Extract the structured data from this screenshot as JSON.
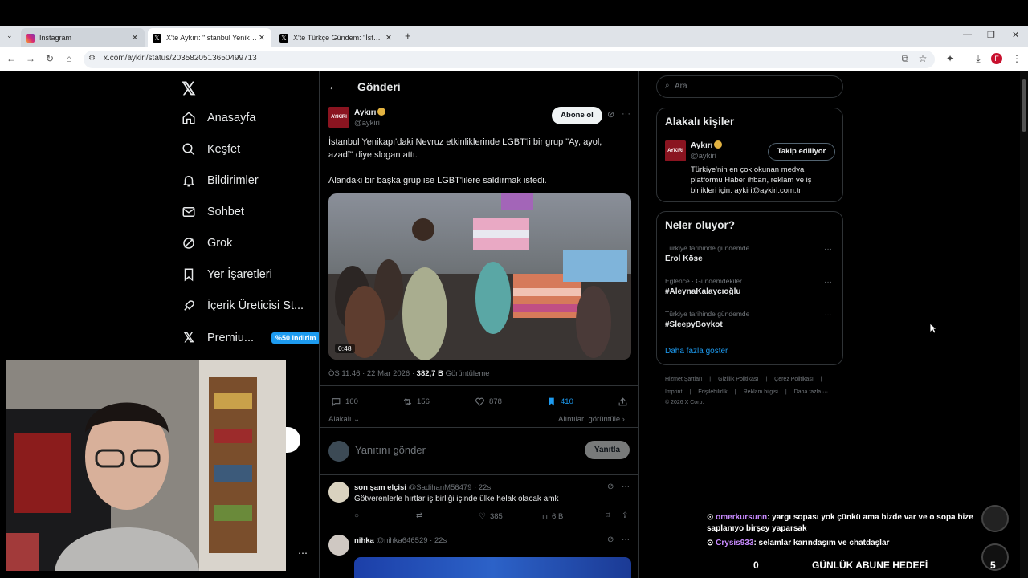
{
  "browser": {
    "tabs": [
      {
        "title": "Instagram",
        "icon": "instagram-icon"
      },
      {
        "title": "X'te Aykırı: \"İstanbul Yenikapı'da...",
        "icon": "x-logo-icon"
      },
      {
        "title": "X'te Türkçe Gündem: \"İstanbul...",
        "icon": "x-logo-icon"
      }
    ],
    "url": "x.com/aykiri/status/2035820513650499713"
  },
  "nav": {
    "items": [
      {
        "label": "Anasayfa",
        "icon": "home-icon"
      },
      {
        "label": "Keşfet",
        "icon": "search-icon"
      },
      {
        "label": "Bildirimler",
        "icon": "bell-icon"
      },
      {
        "label": "Sohbet",
        "icon": "mail-icon"
      },
      {
        "label": "Grok",
        "icon": "grok-icon"
      },
      {
        "label": "Yer İşaretleri",
        "icon": "bookmark-icon"
      },
      {
        "label": "İçerik Üreticisi St...",
        "icon": "rocket-icon"
      },
      {
        "label": "Premiu...",
        "icon": "x-logo-icon"
      }
    ],
    "premium_badge": "%50 indirim"
  },
  "post": {
    "header_title": "Gönderi",
    "author_name": "Aykırı",
    "author_handle": "@aykiri",
    "avatar_text": "AYKIRI",
    "subscribe_label": "Abone ol",
    "text_line1": "İstanbul Yenikapı'daki Nevruz etkinliklerinde LGBT'li bir grup \"Ay, ayol, azadî\" diye slogan attı.",
    "text_line2": "Alandaki bir başka grup ise LGBT'lilere saldırmak istedi.",
    "video_duration": "0:48",
    "timestamp": "ÖS 11:46 · 22 Mar 2026 · ",
    "views": "382,7 B",
    "views_label": " Görüntüleme",
    "replies": "160",
    "reposts": "156",
    "likes": "878",
    "bookmarks": "410",
    "relevant_label": "Alakalı",
    "quotes_label": "Alıntıları görüntüle",
    "reply_placeholder": "Yanıtını gönder",
    "reply_button": "Yanıtla"
  },
  "replies": [
    {
      "name": "son şam elçisi",
      "handle": "@SadihanM56479 · 22s",
      "text": "Götverenlerle hırtlar iş birliği içinde ülke helak olacak amk",
      "likes": "385",
      "views": "6 B"
    },
    {
      "name": "nihka",
      "handle": "@nihka646529 · 22s"
    }
  ],
  "right": {
    "search_placeholder": "Ara",
    "people_title": "Alakalı kişiler",
    "person_name": "Aykırı",
    "person_handle": "@aykiri",
    "person_button": "Takip ediliyor",
    "person_bio": "Türkiye'nin en çok okunan medya platformu Haber ihbarı, reklam ve iş birlikleri için: aykiri@aykiri.com.tr",
    "trends_title": "Neler oluyor?",
    "trends": [
      {
        "meta": "Türkiye tarihinde gündemde",
        "title": "Erol Köse"
      },
      {
        "meta": "Eğlence · Gündemdekiler",
        "title": "#AleynaKalaycıoğlu"
      },
      {
        "meta": "Türkiye tarihinde gündemde",
        "title": "#SleepyBoykot"
      }
    ],
    "show_more": "Daha fazla göster",
    "footer1": [
      "Hizmet Şartları",
      "Gizlilik Politikası",
      "Çerez Politikası"
    ],
    "footer2": [
      "Imprint",
      "Erişilebilirlik",
      "Reklam bilgisi",
      "Daha fazla ···"
    ],
    "copyright": "© 2026 X Corp."
  },
  "overlay": {
    "chat": [
      {
        "user": "omerkursunn",
        "text": ": yargı sopası yok çünkü ama bizde var ve o sopa bize saplanıyo birşey yaparsak",
        "color": "#c98bff"
      },
      {
        "user": "Crysis933",
        "text": ": selamlar karındaşım ve chatdaşlar",
        "color": "#c98bff"
      }
    ],
    "goal_label": "GÜNLÜK ABUNE HEDEFİ",
    "goal_current": "0",
    "goal_target": "5"
  },
  "colors": {
    "accent": "#1d9bf0",
    "badge": "#1d9bf0",
    "brand": "#8a1420"
  }
}
